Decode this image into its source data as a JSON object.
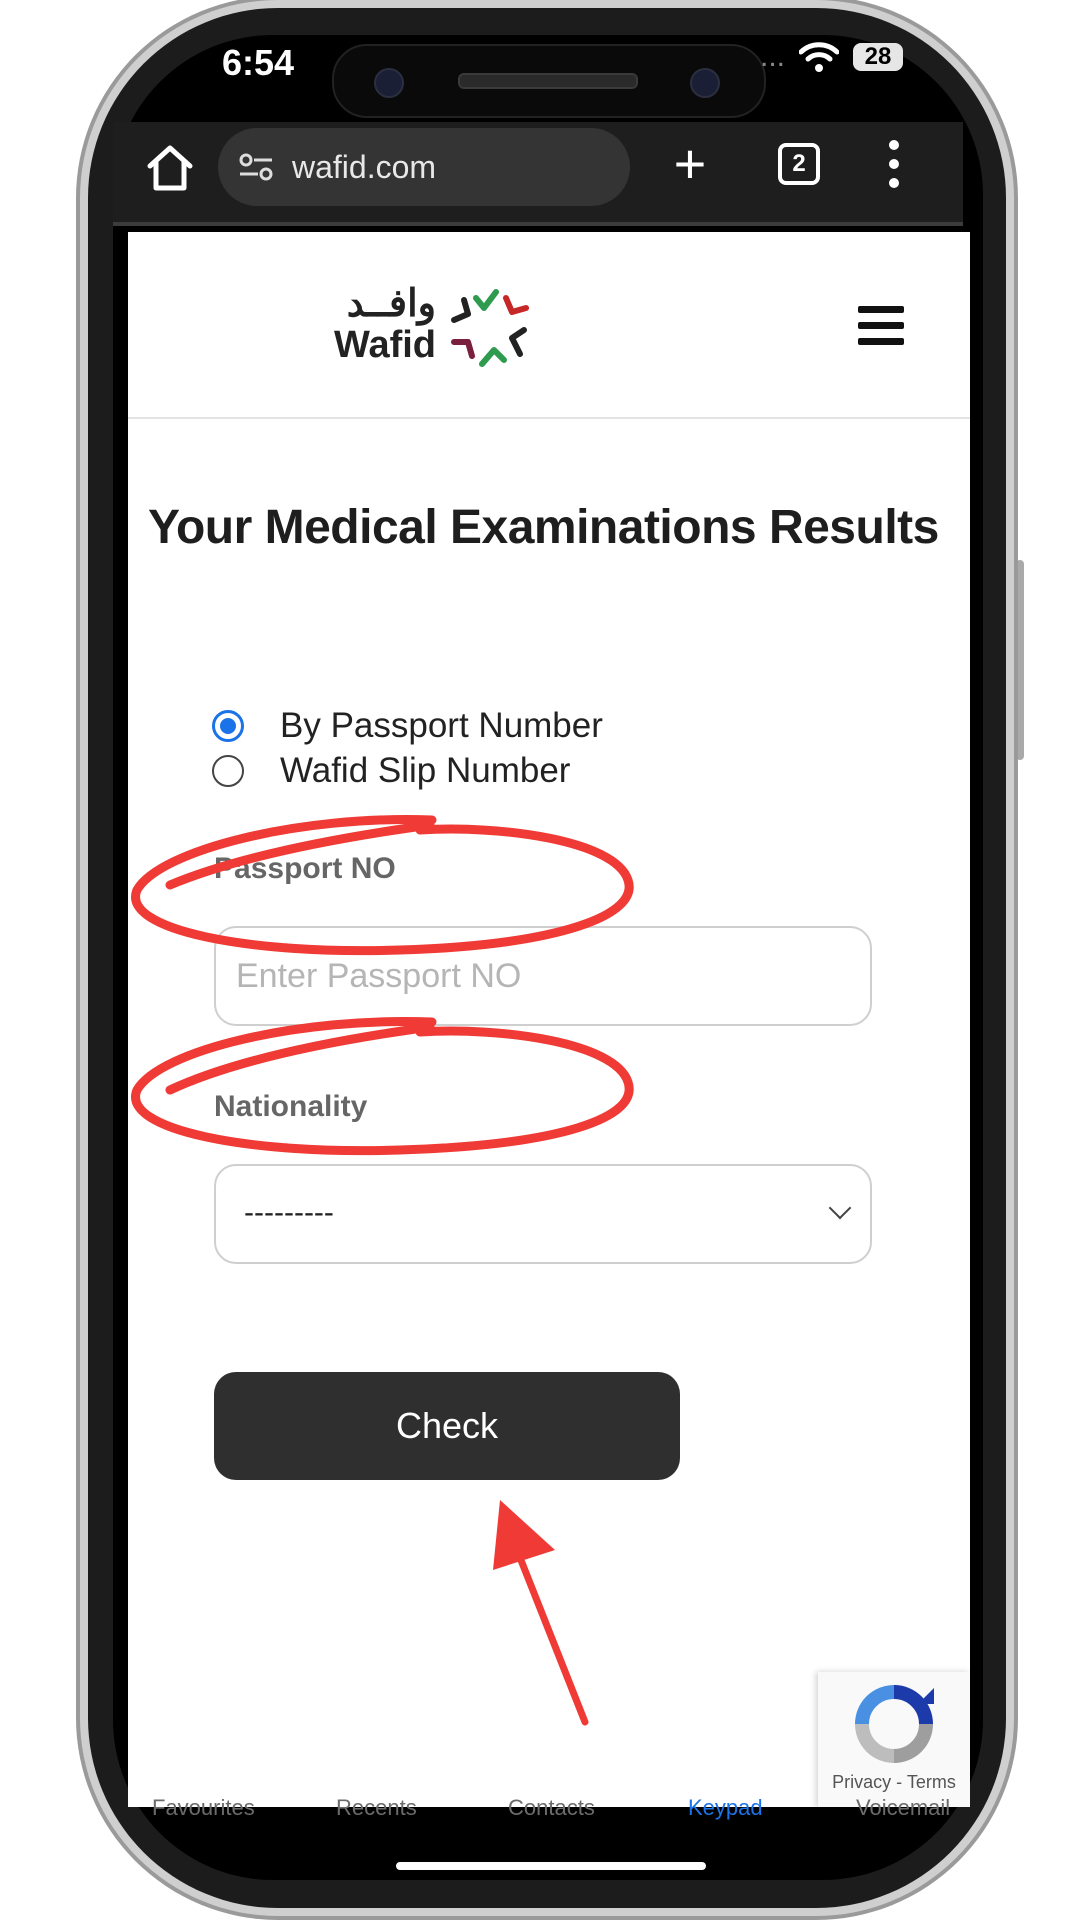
{
  "status_bar": {
    "time": "6:54",
    "battery": "28",
    "overflow": "..."
  },
  "browser": {
    "url": "wafid.com",
    "tab_count": "2",
    "new_tab": "+"
  },
  "site": {
    "logo_arabic": "وافــد",
    "logo_latin": "Wafid"
  },
  "page": {
    "title": "Your Medical Examinations Results",
    "search_options": [
      {
        "label": "By Passport Number",
        "selected": true
      },
      {
        "label": "Wafid Slip Number",
        "selected": false
      }
    ],
    "passport_label": "Passport NO",
    "passport_placeholder": "Enter Passport NO",
    "nationality_label": "Nationality",
    "nationality_value": "---------",
    "check_button": "Check"
  },
  "recaptcha": {
    "privacy": "Privacy",
    "separator": " - ",
    "terms": "Terms"
  },
  "background_tabs": [
    "Favourites",
    "Recents",
    "Contacts",
    "Keypad",
    "Voicemail"
  ],
  "colors": {
    "accent": "#1a73e8",
    "annotation": "#f03a35",
    "button": "#2f2f2f"
  }
}
